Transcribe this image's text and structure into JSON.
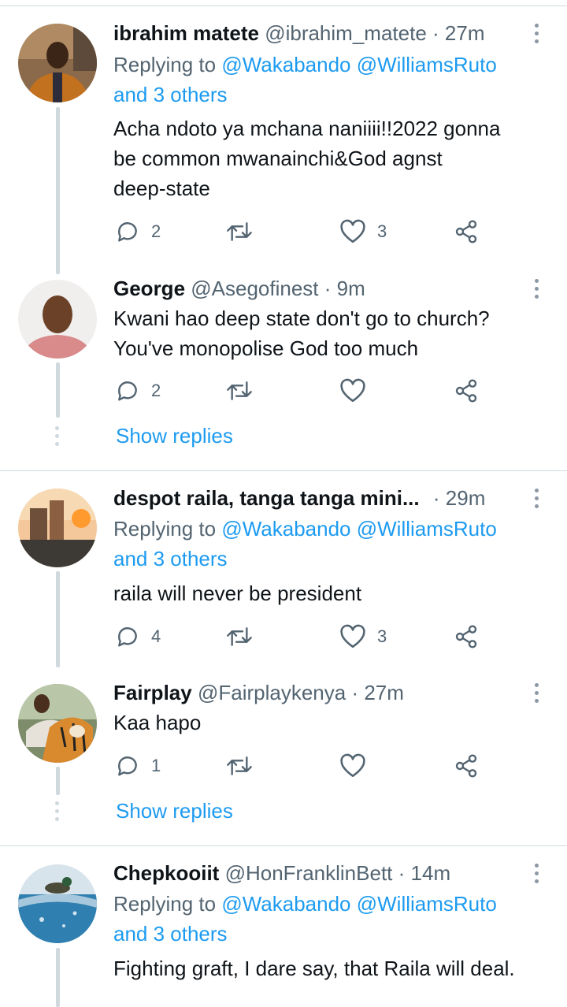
{
  "tweets": [
    {
      "name": "ibrahim matete",
      "handle": "@ibrahim_matete",
      "time": "27m",
      "replying_prefix": "Replying to ",
      "mention1": "@Wakabando",
      "mention2": "@WilliamsRuto",
      "others": "and 3 others",
      "lines": [
        "Acha ndoto ya mchana naniiii!!2022 gonna",
        "be common mwanainchi&God agnst",
        "deep-state"
      ],
      "replies": "2",
      "likes": "3"
    },
    {
      "name": "George",
      "handle": "@Asegofinest",
      "time": "9m",
      "lines": [
        "Kwani hao deep state don't go to church?",
        "You've monopolise God too much"
      ],
      "replies": "2",
      "likes": ""
    },
    {
      "name": "despot raila, tanga tanga mini...",
      "handle": "",
      "time": "29m",
      "replying_prefix": "Replying to ",
      "mention1": "@Wakabando",
      "mention2": "@WilliamsRuto",
      "others": "and 3 others",
      "lines": [
        "raila will never be president"
      ],
      "replies": "4",
      "likes": "3"
    },
    {
      "name": "Fairplay",
      "handle": "@Fairplaykenya",
      "time": "27m",
      "lines": [
        "Kaa hapo"
      ],
      "replies": "1",
      "likes": ""
    },
    {
      "name": "Chepkooiit",
      "handle": "@HonFranklinBett",
      "time": "14m",
      "replying_prefix": "Replying to ",
      "mention1": "@Wakabando",
      "mention2": "@WilliamsRuto",
      "others": "and 3 others",
      "lines": [
        "Fighting graft, I dare say, that Raila will deal."
      ]
    }
  ],
  "separator": "·",
  "show_replies": "Show replies",
  "icons": {
    "reply": "reply-icon",
    "retweet": "retweet-icon",
    "like": "heart-icon",
    "share": "share-icon",
    "more": "more-options-icon"
  },
  "colors": {
    "link": "#1d9bf0",
    "secondary_text": "#536471",
    "text": "#0f1419",
    "divider": "#cfd9de"
  }
}
